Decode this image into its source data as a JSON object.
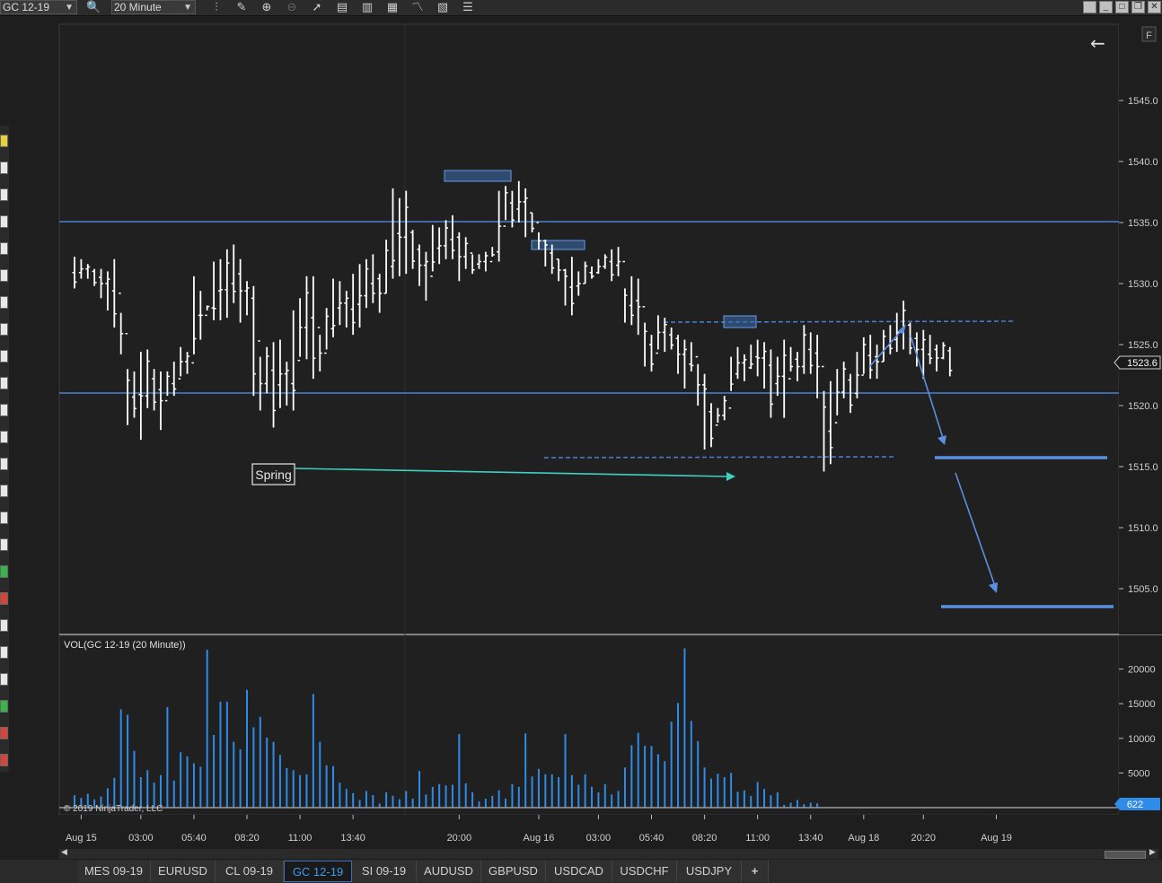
{
  "toolbar": {
    "instrument": "GC 12-19",
    "interval": "20 Minute"
  },
  "chart_label_F": "F",
  "tabs": [
    "MES 09-19",
    "EURUSD",
    "CL 09-19",
    "GC 12-19",
    "SI 09-19",
    "AUDUSD",
    "GBPUSD",
    "USDCAD",
    "USDCHF",
    "USDJPY",
    "+"
  ],
  "active_tab": "GC 12-19",
  "chart_data": {
    "type": "ohlc",
    "price_axis": {
      "ticks": [
        "1545.0",
        "1540.0",
        "1535.0",
        "1530.0",
        "1525.0",
        "1520.0",
        "1515.0",
        "1510.0",
        "1505.0"
      ],
      "ylim": [
        1501.5,
        1547.5
      ],
      "last_price": "1523.6"
    },
    "volume_axis": {
      "ticks": [
        "20000",
        "15000",
        "10000",
        "5000"
      ],
      "last_volume": "622",
      "label": "VOL(GC 12-19 (20 Minute))"
    },
    "time_axis": {
      "ticks": [
        {
          "label": "Aug 15",
          "bar": 1
        },
        {
          "label": "03:00",
          "bar": 10
        },
        {
          "label": "05:40",
          "bar": 18
        },
        {
          "label": "08:20",
          "bar": 26
        },
        {
          "label": "11:00",
          "bar": 34
        },
        {
          "label": "13:40",
          "bar": 42
        },
        {
          "label": "20:00",
          "bar": 58
        },
        {
          "label": "Aug 16",
          "bar": 70
        },
        {
          "label": "03:00",
          "bar": 79
        },
        {
          "label": "05:40",
          "bar": 87
        },
        {
          "label": "08:20",
          "bar": 95
        },
        {
          "label": "11:00",
          "bar": 103
        },
        {
          "label": "13:40",
          "bar": 111
        },
        {
          "label": "Aug 18",
          "bar": 119
        },
        {
          "label": "20:20",
          "bar": 128
        },
        {
          "label": "Aug 19",
          "bar": 139
        }
      ]
    },
    "copyright": "© 2019 NinjaTrader, LLC",
    "bars": [
      [
        1532.2,
        1529.6
      ],
      [
        1532.0,
        1530.4
      ],
      [
        1531.6,
        1530.4
      ],
      [
        1531.2,
        1529.8
      ],
      [
        1531.2,
        1528.8
      ],
      [
        1531.0,
        1527.8
      ],
      [
        1532.0,
        1526.4
      ],
      [
        1527.6,
        1524.2
      ],
      [
        1523.0,
        1518.4
      ],
      [
        1522.8,
        1519.0
      ],
      [
        1524.4,
        1517.2
      ],
      [
        1524.6,
        1519.8
      ],
      [
        1523.0,
        1519.6
      ],
      [
        1522.8,
        1518.0
      ],
      [
        1522.8,
        1520.8
      ],
      [
        1523.6,
        1520.8
      ],
      [
        1524.8,
        1522.4
      ],
      [
        1524.4,
        1522.6
      ],
      [
        1530.6,
        1524.2
      ],
      [
        1529.4,
        1525.4
      ],
      [
        1528.2,
        1527.8
      ],
      [
        1531.8,
        1527.0
      ],
      [
        1532.0,
        1527.0
      ],
      [
        1532.8,
        1527.2
      ],
      [
        1533.2,
        1528.4
      ],
      [
        1532.0,
        1526.8
      ],
      [
        1530.2,
        1527.4
      ],
      [
        1529.8,
        1520.8
      ],
      [
        1524.0,
        1519.6
      ],
      [
        1524.8,
        1521.0
      ],
      [
        1525.2,
        1518.2
      ],
      [
        1525.4,
        1519.8
      ],
      [
        1523.6,
        1520.0
      ],
      [
        1527.8,
        1519.6
      ],
      [
        1528.8,
        1524.0
      ],
      [
        1530.6,
        1523.8
      ],
      [
        1530.6,
        1522.2
      ],
      [
        1525.8,
        1522.8
      ],
      [
        1528.0,
        1524.6
      ],
      [
        1530.4,
        1525.6
      ],
      [
        1530.2,
        1526.6
      ],
      [
        1529.4,
        1526.4
      ],
      [
        1530.8,
        1525.8
      ],
      [
        1531.6,
        1526.4
      ],
      [
        1532.0,
        1528.0
      ],
      [
        1532.4,
        1528.4
      ],
      [
        1530.8,
        1527.6
      ],
      [
        1533.6,
        1529.2
      ],
      [
        1537.8,
        1530.4
      ],
      [
        1537.0,
        1530.6
      ],
      [
        1537.6,
        1530.8
      ],
      [
        1534.4,
        1531.2
      ],
      [
        1533.2,
        1529.8
      ],
      [
        1532.6,
        1528.6
      ],
      [
        1534.8,
        1531.0
      ],
      [
        1534.6,
        1531.6
      ],
      [
        1535.2,
        1532.0
      ],
      [
        1535.6,
        1532.0
      ],
      [
        1534.2,
        1530.2
      ],
      [
        1533.8,
        1531.2
      ],
      [
        1532.4,
        1530.8
      ],
      [
        1532.4,
        1531.2
      ],
      [
        1532.6,
        1531.0
      ],
      [
        1533.0,
        1532.2
      ],
      [
        1537.6,
        1531.8
      ],
      [
        1538.0,
        1535.2
      ],
      [
        1537.6,
        1534.6
      ],
      [
        1538.4,
        1535.0
      ],
      [
        1537.8,
        1533.8
      ],
      [
        1535.8,
        1534.2
      ],
      [
        1534.2,
        1532.8
      ],
      [
        1533.6,
        1531.4
      ],
      [
        1533.2,
        1530.8
      ],
      [
        1532.0,
        1530.2
      ],
      [
        1531.2,
        1528.2
      ],
      [
        1532.2,
        1527.4
      ],
      [
        1531.0,
        1529.0
      ],
      [
        1531.8,
        1530.0
      ],
      [
        1531.4,
        1530.4
      ],
      [
        1532.0,
        1530.8
      ],
      [
        1532.4,
        1531.2
      ],
      [
        1532.8,
        1530.2
      ],
      [
        1533.0,
        1530.6
      ],
      [
        1529.6,
        1526.8
      ],
      [
        1530.6,
        1526.6
      ],
      [
        1530.4,
        1525.8
      ],
      [
        1526.8,
        1523.2
      ],
      [
        1525.8,
        1522.8
      ],
      [
        1527.4,
        1524.6
      ],
      [
        1527.2,
        1524.4
      ],
      [
        1526.4,
        1524.6
      ],
      [
        1525.8,
        1522.6
      ],
      [
        1525.4,
        1521.4
      ],
      [
        1525.2,
        1522.8
      ],
      [
        1523.4,
        1520.0
      ],
      [
        1522.6,
        1516.4
      ],
      [
        1520.2,
        1516.6
      ],
      [
        1519.8,
        1518.6
      ],
      [
        1520.8,
        1518.8
      ],
      [
        1524.0,
        1521.2
      ],
      [
        1524.8,
        1522.2
      ],
      [
        1524.2,
        1522.0
      ],
      [
        1525.0,
        1523.0
      ],
      [
        1525.4,
        1522.4
      ],
      [
        1525.2,
        1521.4
      ],
      [
        1524.6,
        1519.0
      ],
      [
        1524.0,
        1520.8
      ],
      [
        1525.4,
        1519.0
      ],
      [
        1524.8,
        1522.8
      ],
      [
        1524.4,
        1522.0
      ],
      [
        1526.6,
        1522.6
      ],
      [
        1526.0,
        1522.6
      ],
      [
        1525.8,
        1520.6
      ],
      [
        1521.2,
        1514.6
      ],
      [
        1522.0,
        1515.2
      ],
      [
        1523.0,
        1519.2
      ],
      [
        1523.6,
        1520.6
      ],
      [
        1522.6,
        1519.4
      ],
      [
        1524.4,
        1520.6
      ],
      [
        1525.6,
        1522.6
      ],
      [
        1525.8,
        1522.2
      ],
      [
        1525.0,
        1522.2
      ],
      [
        1526.2,
        1523.6
      ],
      [
        1526.6,
        1524.2
      ],
      [
        1527.6,
        1524.4
      ],
      [
        1528.6,
        1524.6
      ],
      [
        1526.8,
        1524.2
      ],
      [
        1526.0,
        1523.2
      ],
      [
        1526.2,
        1522.2
      ],
      [
        1525.8,
        1523.4
      ],
      [
        1525.0,
        1522.8
      ],
      [
        1525.2,
        1523.8
      ],
      [
        1524.8,
        1522.4
      ]
    ],
    "volume": [
      1800,
      1400,
      2000,
      1200,
      1600,
      2800,
      4300,
      14200,
      13400,
      8200,
      4400,
      5400,
      3600,
      4700,
      14500,
      3900,
      8000,
      7400,
      6400,
      5900,
      22800,
      10500,
      15300,
      15300,
      9500,
      8400,
      17000,
      11600,
      13100,
      10100,
      9500,
      7600,
      5700,
      5400,
      4700,
      4800,
      16400,
      9500,
      6100,
      6000,
      3600,
      2700,
      2100,
      1100,
      2400,
      1800,
      600,
      2200,
      1700,
      1200,
      2400,
      1300,
      5300,
      1900,
      3000,
      3400,
      3200,
      3300,
      10600,
      3500,
      2200,
      900,
      1300,
      1700,
      2500,
      1300,
      3400,
      3000,
      10700,
      4500,
      5600,
      4800,
      4800,
      4400,
      10600,
      4700,
      3300,
      4800,
      3000,
      2200,
      3400,
      1900,
      2400,
      5800,
      9000,
      10800,
      8900,
      8900,
      7700,
      6700,
      12400,
      15100,
      23000,
      12500,
      9600,
      5800,
      4200,
      4900,
      4400,
      5000,
      2300,
      2500,
      1700,
      3700,
      2700,
      1800,
      2200,
      400,
      700,
      1100,
      500,
      700,
      622
    ]
  }
}
